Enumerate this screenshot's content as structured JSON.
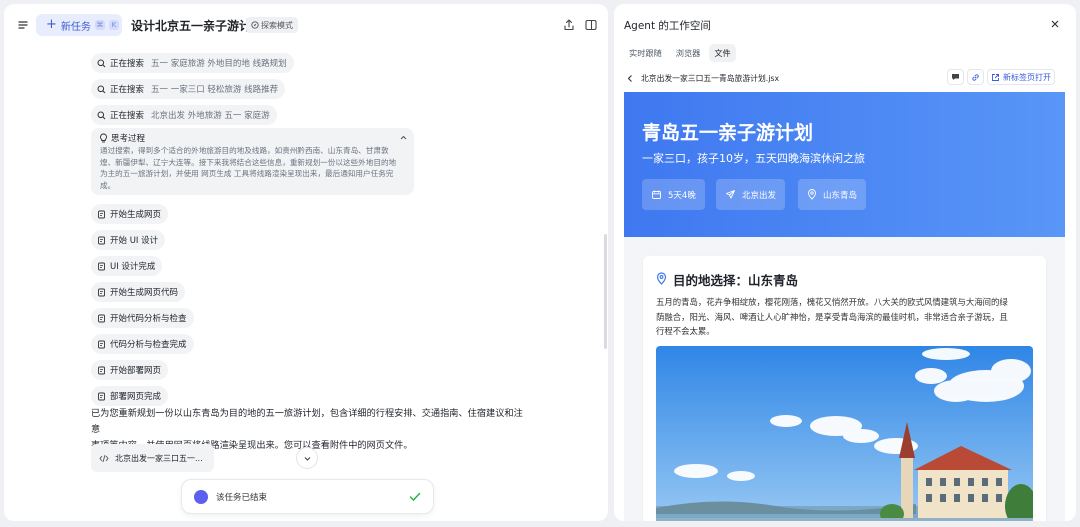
{
  "left": {
    "new_task_label": "新任务",
    "new_task_keys": [
      "⌘",
      "K"
    ],
    "task_title": "设计北京五一亲子游计划",
    "mode_badge": "探索模式",
    "steps": [
      {
        "label": "正在搜索",
        "detail": "五一 家庭旅游 外地目的地 线路规划",
        "icon": "search-icon"
      },
      {
        "label": "正在搜索",
        "detail": "五一 一家三口 轻松旅游 线路推荐",
        "icon": "search-icon"
      },
      {
        "label": "正在搜索",
        "detail": "北京出发 外地旅游 五一 家庭游",
        "icon": "search-icon"
      }
    ],
    "thinking": {
      "title": "思考过程",
      "lines": [
        "通过搜索，得到多个适合的外地旅游目的地及线路，如贵州黔西南、山东青岛、甘肃敦",
        "煌、新疆伊犁、辽宁大连等。接下来我将结合这些信息，重新规划一份以这些外地目的地",
        "为主的五一旅游计划，并使用 网页生成 工具将线路渲染呈现出来，最后通知用户任务完",
        "成。"
      ]
    },
    "actions": [
      "开始生成网页",
      "开始 UI 设计",
      "UI 设计完成",
      "开始生成网页代码",
      "开始代码分析与检查",
      "代码分析与检查完成",
      "开始部署网页",
      "部署网页完成"
    ],
    "summary_lines": [
      "已为您重新规划一份以山东青岛为目的地的五一旅游计划，包含详细的行程安排、交通指南、住宿建议和注意",
      "事项等内容，并使用网页将线路渲染呈现出来。您可以查看附件中的网页文件。"
    ],
    "attachment_name": "北京出发一家三口五一...",
    "end_status": "该任务已结束"
  },
  "right": {
    "workspace_title": "Agent 的工作空间",
    "tabs": [
      "实时跟随",
      "浏览器",
      "文件"
    ],
    "active_tab": "文件",
    "file_path": "北京出发一家三口五一青岛旅游计划.jsx",
    "open_new_tab_label": "新标签页打开",
    "preview": {
      "hero_title": "青岛五一亲子游计划",
      "hero_subtitle": "一家三口，孩子10岁，五天四晚海滨休闲之旅",
      "pills": [
        {
          "icon": "calendar-icon",
          "text": "5天4晚"
        },
        {
          "icon": "plane-icon",
          "text": "北京出发"
        },
        {
          "icon": "location-icon",
          "text": "山东青岛"
        }
      ],
      "section_title": "目的地选择：山东青岛",
      "section_desc": [
        "五月的青岛，花卉争相绽放，樱花刚落，槐花又悄然开放。八大关的欧式风情建筑与大海间的绿",
        "荫融合，阳光、海风、啤酒让人心旷神怡，是享受青岛海滨的最佳时机，非常适合亲子游玩，且",
        "行程不会太累。"
      ]
    }
  },
  "colors": {
    "accent": "#3e5ccf",
    "hero": "#4a84f3",
    "success": "#2bb14e"
  }
}
